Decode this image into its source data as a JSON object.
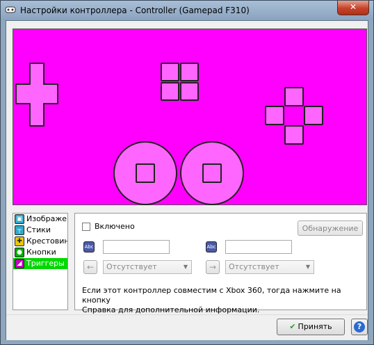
{
  "window": {
    "title": "Настройки контроллера - Controller (Gamepad F310)",
    "close_label": "✕"
  },
  "preview": {
    "background": "#ff00ff",
    "element_fill": "#ff66ff"
  },
  "sidebar": {
    "items": [
      {
        "label": "Изображение",
        "icon": "image-icon",
        "color": "#2fa8c8"
      },
      {
        "label": "Стики",
        "icon": "stick-icon",
        "color": "#2fa8c8"
      },
      {
        "label": "Крестовина",
        "icon": "dpad-icon",
        "color": "#e8c800"
      },
      {
        "label": "Кнопки",
        "icon": "buttons-icon",
        "color": "#00b000"
      },
      {
        "label": "Триггеры",
        "icon": "trigger-icon",
        "color": "#c000c0",
        "selected": true
      }
    ]
  },
  "panel": {
    "enabled_label": "Включено",
    "detect_label": "Обнаружение",
    "abc_label": "Abc",
    "left_select": "Отсутствует",
    "right_select": "Отсутствует",
    "left_arrow": "←",
    "right_arrow": "→",
    "info_line1": "Если этот контроллер совместим с Xbox 360, тогда нажмите на кнопку",
    "info_line2": "Справка для дополнительной информации."
  },
  "footer": {
    "accept_label": "Принять",
    "help_label": "?"
  }
}
